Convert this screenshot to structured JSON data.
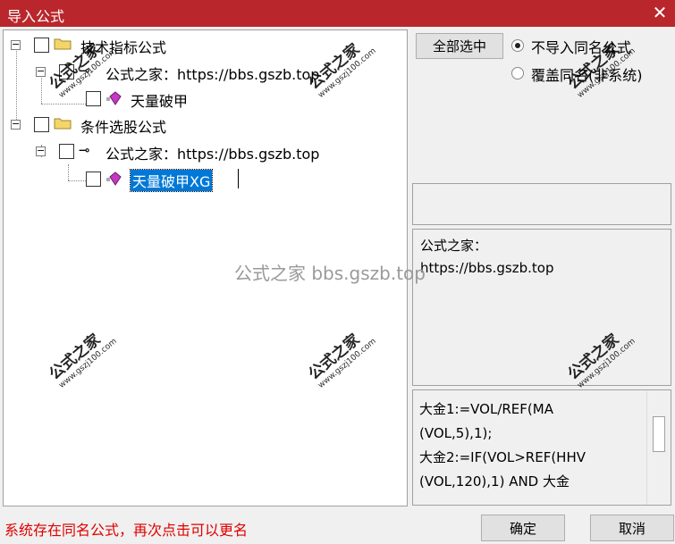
{
  "window": {
    "title": "导入公式",
    "close": "✕"
  },
  "tree": {
    "group1": {
      "label": "技术指标公式"
    },
    "group1_source": {
      "label": "公式之家：https://bbs.gszb.top"
    },
    "group1_item": {
      "label": "天量破甲"
    },
    "group2": {
      "label": "条件选股公式"
    },
    "group2_source": {
      "label": "公式之家：https://bbs.gszb.top"
    },
    "group2_item": {
      "label": "天量破甲XG"
    }
  },
  "options": {
    "select_all_label": "全部选中",
    "radio_no_import": "不导入同名公式",
    "radio_overwrite": "覆盖同名(非系统)",
    "selected": "radio_no_import"
  },
  "info": {
    "line1": "公式之家：",
    "line2": "https://bbs.gszb.top"
  },
  "code": {
    "lines": [
      "大金1:=VOL/REF(MA",
      "(VOL,5),1);",
      "大金2:=IF(VOL>REF(HHV",
      "(VOL,120),1) AND 大金"
    ]
  },
  "status": "系统存在同名公式，再次点击可以更名",
  "buttons": {
    "ok": "确定",
    "cancel": "取消"
  },
  "watermark": {
    "text": "公式之家",
    "url": "www.gszj100.com",
    "center": "公式之家 bbs.gszb.top"
  }
}
